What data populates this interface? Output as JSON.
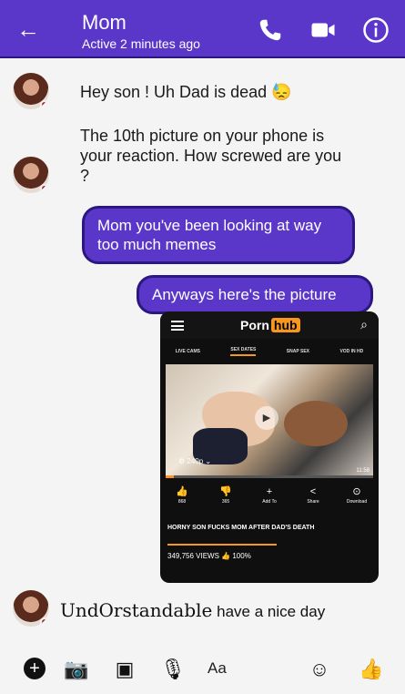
{
  "header": {
    "contact_name": "Mom",
    "status": "Active 2 minutes ago",
    "back_icon": "arrow-left-icon",
    "phone_icon": "phone-icon",
    "video_icon": "video-camera-icon",
    "info_icon": "info-icon",
    "bg_color": "#5b37c9"
  },
  "messages": {
    "incoming_1": "Hey son ! Uh Dad is dead 😓",
    "incoming_2": "The 10th picture on your phone is your reaction. How screwed are you ?",
    "outgoing_1": "Mom you've been looking at way too much memes",
    "outgoing_2": "Anyways here's the picture",
    "incoming_3_stylized": "UndOrstandable",
    "incoming_3_rest": "have a nice day"
  },
  "attachment": {
    "brand_name": "Porn",
    "brand_hub": "hub",
    "nav": [
      "LIVE CAMS",
      "SEX DATES",
      "SNAP SEX",
      "VOD IN HD"
    ],
    "quality": "⚙ 240p ⌄",
    "time": "11:58",
    "progress": 0.04,
    "actions": [
      {
        "icon": "thumbs-up-icon",
        "count": "868"
      },
      {
        "icon": "thumbs-down-icon",
        "count": "365"
      },
      {
        "icon": "plus-icon",
        "count": "Add To"
      },
      {
        "icon": "share-icon",
        "count": "Share"
      },
      {
        "icon": "download-icon",
        "count": "Download"
      }
    ],
    "video_title": "HORNY SON FUCKS MOM AFTER DAD'S DEATH",
    "views": "349,756 VIEWS",
    "rating": "👍 100%"
  },
  "composer": {
    "placeholder": "Aa",
    "icons": [
      "plus-icon",
      "camera-icon",
      "image-icon",
      "microphone-icon",
      "smiley-icon",
      "thumbs-up-icon"
    ]
  }
}
